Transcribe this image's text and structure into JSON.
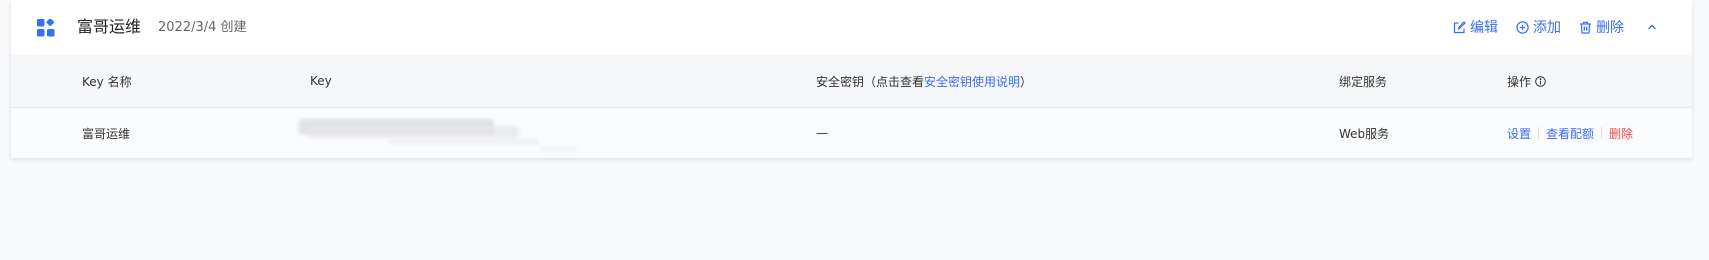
{
  "header": {
    "app_name": "富哥运维",
    "created_text": "2022/3/4 创建",
    "actions": {
      "edit": "编辑",
      "add": "添加",
      "delete": "删除"
    }
  },
  "table": {
    "columns": {
      "key_name": "Key 名称",
      "key": "Key",
      "secret_prefix": "安全密钥（点击查看",
      "secret_link": "安全密钥使用说明",
      "secret_suffix": "）",
      "bound_service": "绑定服务",
      "operations": "操作"
    },
    "rows": [
      {
        "key_name": "富哥运维",
        "secret": "—",
        "bound_service": "Web服务",
        "actions": {
          "settings": "设置",
          "view_quota": "查看配额",
          "delete": "删除"
        }
      }
    ]
  },
  "colors": {
    "accent": "#3a6ef0",
    "danger": "#f04a4a"
  }
}
